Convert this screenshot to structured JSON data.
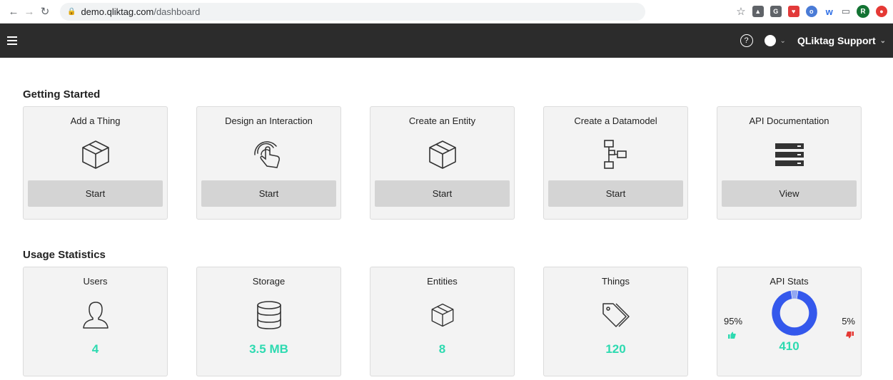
{
  "browser": {
    "url_domain": "demo.qliktag.com",
    "url_path": "/dashboard",
    "avatar_letter": "R"
  },
  "header": {
    "user_name": "QLiktag Support"
  },
  "getting_started": {
    "title": "Getting Started",
    "cards": [
      {
        "title": "Add a Thing",
        "button": "Start",
        "icon": "box-icon"
      },
      {
        "title": "Design an Interaction",
        "button": "Start",
        "icon": "touch-icon"
      },
      {
        "title": "Create an Entity",
        "button": "Start",
        "icon": "box-icon"
      },
      {
        "title": "Create a Datamodel",
        "button": "Start",
        "icon": "datamodel-icon"
      },
      {
        "title": "API Documentation",
        "button": "View",
        "icon": "server-icon"
      }
    ]
  },
  "usage_statistics": {
    "title": "Usage Statistics",
    "cards": [
      {
        "title": "Users",
        "value": "4",
        "icon": "user-icon"
      },
      {
        "title": "Storage",
        "value": "3.5 MB",
        "icon": "database-icon"
      },
      {
        "title": "Entities",
        "value": "8",
        "icon": "box-icon"
      },
      {
        "title": "Things",
        "value": "120",
        "icon": "tags-icon"
      }
    ],
    "api_stats": {
      "title": "API Stats",
      "positive_pct": "95%",
      "negative_pct": "5%",
      "total": "410"
    }
  },
  "chart_data": {
    "type": "pie",
    "categories": [
      "positive",
      "negative"
    ],
    "values": [
      95,
      5
    ]
  },
  "colors": {
    "accent": "#2ddab0",
    "donut_main": "#3458ec",
    "donut_minor": "#93a8f2",
    "thumb_up": "#2ddab0",
    "thumb_down": "#e53935"
  }
}
